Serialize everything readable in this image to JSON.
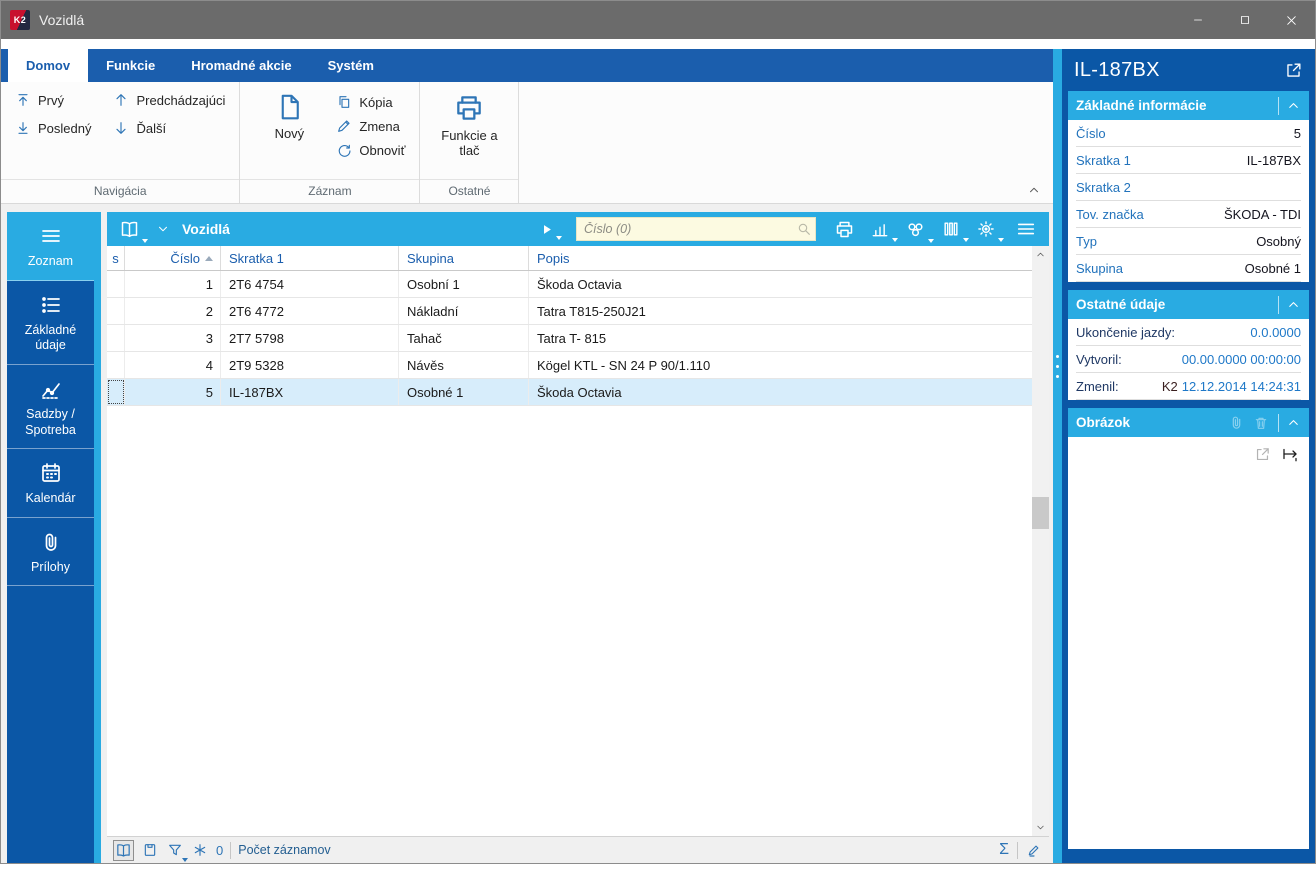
{
  "window": {
    "title": "Vozidlá",
    "logo_text": "K2"
  },
  "ribbon": {
    "tabs": [
      {
        "label": "Domov",
        "active": true
      },
      {
        "label": "Funkcie",
        "active": false
      },
      {
        "label": "Hromadné akcie",
        "active": false
      },
      {
        "label": "Systém",
        "active": false
      }
    ],
    "navigacia": {
      "label": "Navigácia",
      "first": "Prvý",
      "last": "Posledný",
      "previous": "Predchádzajúci",
      "next": "Ďalší"
    },
    "zaznam": {
      "label": "Záznam",
      "new": "Nový",
      "copy": "Kópia",
      "change": "Zmena",
      "refresh": "Obnoviť"
    },
    "ostatne": {
      "label": "Ostatné",
      "functions_print": "Funkcie a tlač"
    }
  },
  "sidebar": {
    "items": [
      {
        "label": "Zoznam",
        "icon": "menu-icon",
        "active": true
      },
      {
        "label": "Základné údaje",
        "icon": "list-icon",
        "active": false
      },
      {
        "label": "Sadzby / Spotreba",
        "icon": "line-chart-icon",
        "active": false
      },
      {
        "label": "Kalendár",
        "icon": "calendar-icon",
        "active": false
      },
      {
        "label": "Prílohy",
        "icon": "paperclip-icon",
        "active": false
      }
    ]
  },
  "grid": {
    "title": "Vozidlá",
    "search_placeholder": "Číslo (0)",
    "columns": {
      "s": "s",
      "cislo": "Číslo",
      "skratka1": "Skratka 1",
      "skupina": "Skupina",
      "popis": "Popis"
    },
    "sorted_by": "Číslo",
    "rows": [
      {
        "cislo": "1",
        "skratka1": "2T6 4754",
        "skupina": "Osobní 1",
        "popis": "Škoda Octavia"
      },
      {
        "cislo": "2",
        "skratka1": "2T6 4772",
        "skupina": "Nákladní",
        "popis": "Tatra T815-250J21"
      },
      {
        "cislo": "3",
        "skratka1": "2T7 5798",
        "skupina": "Tahač",
        "popis": "Tatra T- 815"
      },
      {
        "cislo": "4",
        "skratka1": "2T9 5328",
        "skupina": "Návěs",
        "popis": "Kögel KTL - SN 24 P 90/1.110"
      },
      {
        "cislo": "5",
        "skratka1": "IL-187BX",
        "skupina": "Osobné 1",
        "popis": "Škoda Octavia"
      }
    ],
    "selected_row_index": 4,
    "status": {
      "filter_count": "0",
      "records_label": "Počet záznamov",
      "sum_symbol": "Σ"
    }
  },
  "detail": {
    "title": "IL-187BX",
    "basic": {
      "title": "Základné informácie",
      "rows": [
        {
          "label": "Číslo",
          "value": "5"
        },
        {
          "label": "Skratka 1",
          "value": "IL-187BX"
        },
        {
          "label": "Skratka 2",
          "value": ""
        },
        {
          "label": "Tov. značka",
          "value": "ŠKODA - TDI"
        },
        {
          "label": "Typ",
          "value": "Osobný"
        },
        {
          "label": "Skupina",
          "value": "Osobné 1"
        }
      ]
    },
    "other": {
      "title": "Ostatné údaje",
      "rows": [
        {
          "label": "Ukončenie jazdy:",
          "prefix": "",
          "value": "0.0.0000"
        },
        {
          "label": "Vytvoril:",
          "prefix": "",
          "value": "00.00.0000 00:00:00"
        },
        {
          "label": "Zmenil:",
          "prefix": "K2",
          "value": "12.12.2014 14:24:31"
        }
      ]
    },
    "image": {
      "title": "Obrázok"
    }
  },
  "icons": [
    "minimize-icon",
    "maximize-icon",
    "close-icon",
    "arrow-up-to-bar-icon",
    "arrow-down-to-bar-icon",
    "arrow-up-icon",
    "arrow-down-icon",
    "document-icon",
    "copy-icon",
    "pencil-icon",
    "refresh-icon",
    "printer-icon",
    "book-icon",
    "chevron-down-icon",
    "chevron-up-icon",
    "play-icon",
    "search-icon",
    "bar-chart-icon",
    "gears-icon",
    "columns-icon",
    "gear-icon",
    "hamburger-icon",
    "list-icon",
    "line-chart-icon",
    "calendar-icon",
    "paperclip-icon",
    "external-link-icon",
    "trash-icon",
    "resize-horizontal-icon",
    "filter-icon",
    "snowflake-icon",
    "card-box-icon",
    "sigma-icon"
  ],
  "colors": {
    "titlebar_gray": "#6B6B6B",
    "ribbon_blue": "#1B5EAD",
    "panel_dark_blue": "#0B57A6",
    "accent_light_blue": "#29ABE2",
    "icon_blue": "#2E75B6",
    "selected_row": "#D7EDFB",
    "search_bg": "#FCFAE1"
  }
}
